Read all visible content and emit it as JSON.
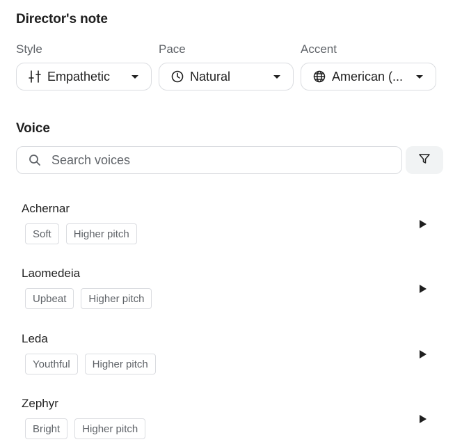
{
  "director": {
    "title": "Director's note",
    "style": {
      "label": "Style",
      "value": "Empathetic",
      "icon": "sliders-icon"
    },
    "pace": {
      "label": "Pace",
      "value": "Natural",
      "icon": "clock-icon"
    },
    "accent": {
      "label": "Accent",
      "value": "American (...",
      "icon": "globe-icon"
    }
  },
  "voice": {
    "title": "Voice",
    "search": {
      "placeholder": "Search voices",
      "value": "",
      "icon": "search-icon"
    },
    "filter_icon": "filter-icon",
    "items": [
      {
        "name": "Achernar",
        "tags": [
          "Soft",
          "Higher pitch"
        ]
      },
      {
        "name": "Laomedeia",
        "tags": [
          "Upbeat",
          "Higher pitch"
        ]
      },
      {
        "name": "Leda",
        "tags": [
          "Youthful",
          "Higher pitch"
        ]
      },
      {
        "name": "Zephyr",
        "tags": [
          "Bright",
          "Higher pitch"
        ]
      }
    ]
  }
}
